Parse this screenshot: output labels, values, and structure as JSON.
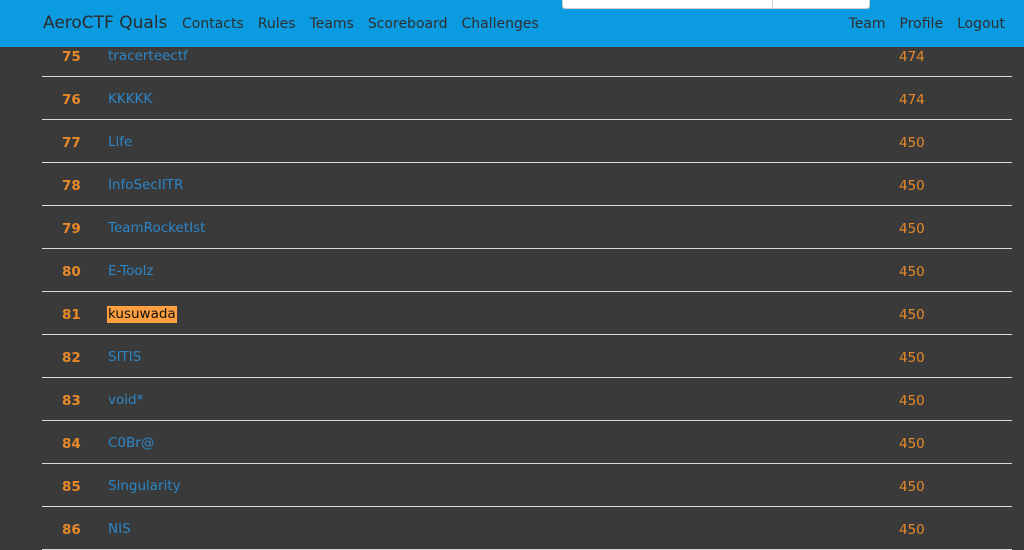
{
  "nav": {
    "brand": "AeroCTF Quals",
    "left": [
      "Contacts",
      "Rules",
      "Teams",
      "Scoreboard",
      "Challenges"
    ],
    "right": [
      "Team",
      "Profile",
      "Logout"
    ]
  },
  "colors": {
    "navbar": "#0b9be0",
    "background": "#3a3a3a",
    "rank": "#e8892a",
    "team_link": "#2c86c8",
    "highlight": "#ff9f3f"
  },
  "scoreboard": {
    "rows": [
      {
        "rank": "75",
        "team": "tracerteectf",
        "score": "474",
        "highlight": false
      },
      {
        "rank": "76",
        "team": "KKKKK",
        "score": "474",
        "highlight": false
      },
      {
        "rank": "77",
        "team": "Life",
        "score": "450",
        "highlight": false
      },
      {
        "rank": "78",
        "team": "InfoSecIITR",
        "score": "450",
        "highlight": false
      },
      {
        "rank": "79",
        "team": "TeamRocketIst",
        "score": "450",
        "highlight": false
      },
      {
        "rank": "80",
        "team": "E-Toolz",
        "score": "450",
        "highlight": false
      },
      {
        "rank": "81",
        "team": "kusuwada",
        "score": "450",
        "highlight": true
      },
      {
        "rank": "82",
        "team": "SITIS",
        "score": "450",
        "highlight": false
      },
      {
        "rank": "83",
        "team": "void*",
        "score": "450",
        "highlight": false
      },
      {
        "rank": "84",
        "team": "C0Br@",
        "score": "450",
        "highlight": false
      },
      {
        "rank": "85",
        "team": "Singularity",
        "score": "450",
        "highlight": false
      },
      {
        "rank": "86",
        "team": "NIS",
        "score": "450",
        "highlight": false
      }
    ]
  }
}
